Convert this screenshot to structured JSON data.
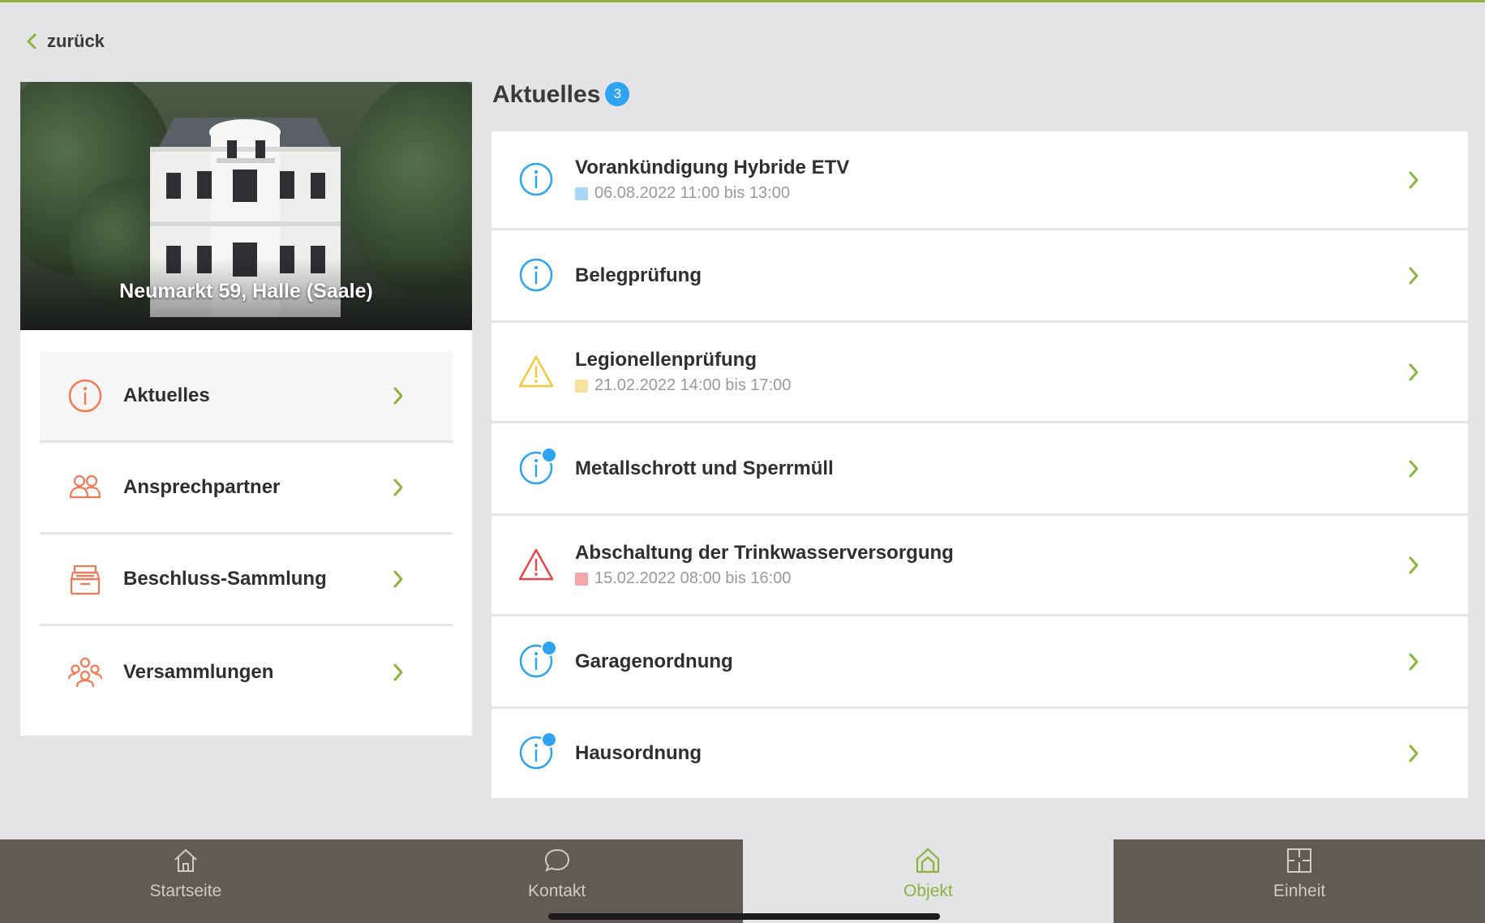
{
  "nav": {
    "back_label": "zurück"
  },
  "property": {
    "address": "Neumarkt 59, Halle (Saale)"
  },
  "menu": {
    "items": [
      {
        "label": "Aktuelles",
        "icon": "info-icon",
        "active": true
      },
      {
        "label": "Ansprechpartner",
        "icon": "people-icon",
        "active": false
      },
      {
        "label": "Beschluss-Sammlung",
        "icon": "archive-icon",
        "active": false
      },
      {
        "label": "Versammlungen",
        "icon": "group-icon",
        "active": false
      }
    ]
  },
  "news": {
    "title": "Aktuelles",
    "count": "3",
    "items": [
      {
        "title": "Vorankündigung Hybride ETV",
        "date": "06.08.2022 11:00 bis 13:00",
        "icon": "info-icon",
        "unread": false,
        "color": "#2ea3f2"
      },
      {
        "title": "Belegprüfung",
        "date": "",
        "icon": "info-icon",
        "unread": false,
        "color": "#2ea3f2"
      },
      {
        "title": "Legionellenprüfung",
        "date": "21.02.2022 14:00 bis 17:00",
        "icon": "warning-icon",
        "unread": false,
        "color": "#f2c93a"
      },
      {
        "title": "Metallschrott und Sperrmüll",
        "date": "",
        "icon": "info-icon",
        "unread": true,
        "color": "#2ea3f2"
      },
      {
        "title": "Abschaltung der Trinkwasserversorgung",
        "date": "15.02.2022 08:00 bis 16:00",
        "icon": "alert-icon",
        "unread": false,
        "color": "#e5474b"
      },
      {
        "title": "Garagenordnung",
        "date": "",
        "icon": "info-icon",
        "unread": true,
        "color": "#2ea3f2"
      },
      {
        "title": "Hausordnung",
        "date": "",
        "icon": "info-icon",
        "unread": true,
        "color": "#2ea3f2"
      }
    ]
  },
  "tabs": [
    {
      "label": "Startseite",
      "icon": "home-icon",
      "active": false
    },
    {
      "label": "Kontakt",
      "icon": "chat-bubble-icon",
      "active": false
    },
    {
      "label": "Objekt",
      "icon": "building-icon",
      "active": true
    },
    {
      "label": "Einheit",
      "icon": "floorplan-icon",
      "active": false
    }
  ],
  "colors": {
    "accent": "#8cb33e",
    "info": "#2ea3f2",
    "warning": "#f2c93a",
    "danger": "#e5474b",
    "menu_icon": "#f07a55",
    "tabbar": "#5f5b55"
  }
}
